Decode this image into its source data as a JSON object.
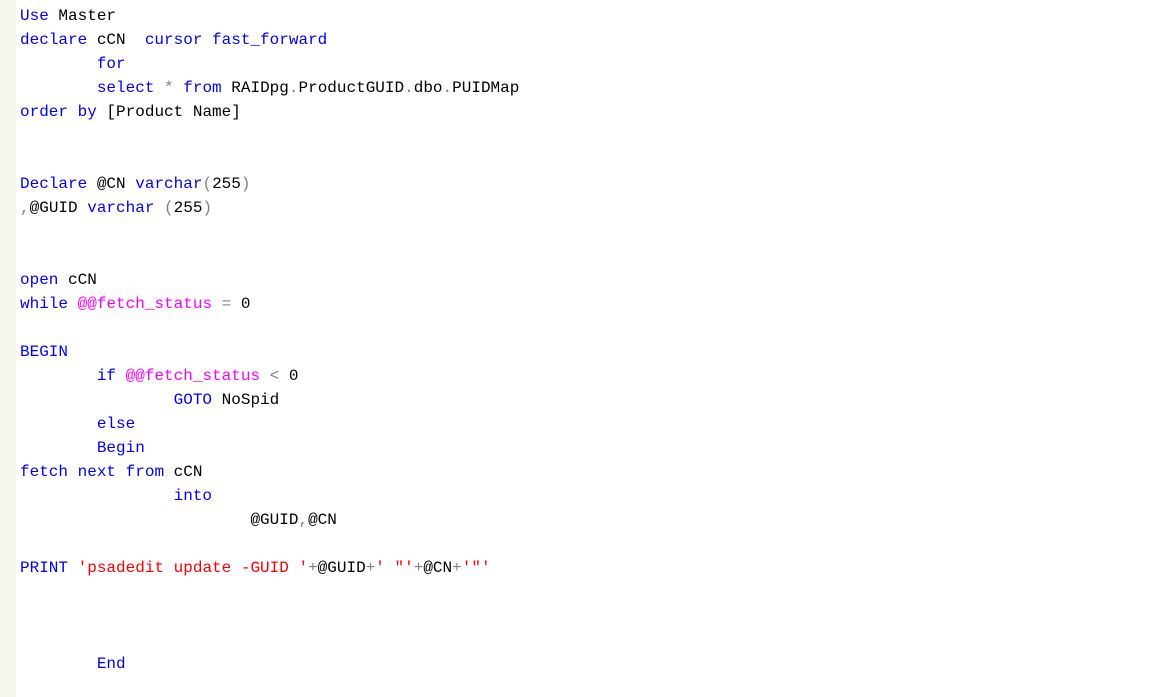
{
  "code": {
    "tokens": [
      [
        {
          "t": "Use",
          "c": "kw"
        },
        {
          "t": " Master",
          "c": "id"
        }
      ],
      [
        {
          "t": "declare",
          "c": "kw"
        },
        {
          "t": " cCN  ",
          "c": "id"
        },
        {
          "t": "cursor",
          "c": "kw"
        },
        {
          "t": " ",
          "c": "id"
        },
        {
          "t": "fast_forward",
          "c": "kw"
        }
      ],
      [
        {
          "t": "        ",
          "c": "id"
        },
        {
          "t": "for",
          "c": "kw"
        }
      ],
      [
        {
          "t": "        ",
          "c": "id"
        },
        {
          "t": "select",
          "c": "kw"
        },
        {
          "t": " ",
          "c": "id"
        },
        {
          "t": "*",
          "c": "op"
        },
        {
          "t": " ",
          "c": "id"
        },
        {
          "t": "from",
          "c": "kw"
        },
        {
          "t": " RAIDpg",
          "c": "id"
        },
        {
          "t": ".",
          "c": "op"
        },
        {
          "t": "ProductGUID",
          "c": "id"
        },
        {
          "t": ".",
          "c": "op"
        },
        {
          "t": "dbo",
          "c": "id"
        },
        {
          "t": ".",
          "c": "op"
        },
        {
          "t": "PUIDMap",
          "c": "id"
        }
      ],
      [
        {
          "t": "order",
          "c": "kw"
        },
        {
          "t": " ",
          "c": "id"
        },
        {
          "t": "by",
          "c": "kw"
        },
        {
          "t": " [Product Name]",
          "c": "id"
        }
      ],
      [],
      [],
      [
        {
          "t": "Declare",
          "c": "kw"
        },
        {
          "t": " @CN ",
          "c": "id"
        },
        {
          "t": "varchar",
          "c": "kw"
        },
        {
          "t": "(",
          "c": "op"
        },
        {
          "t": "255",
          "c": "id"
        },
        {
          "t": ")",
          "c": "op"
        }
      ],
      [
        {
          "t": ",",
          "c": "op"
        },
        {
          "t": "@GUID ",
          "c": "id"
        },
        {
          "t": "varchar",
          "c": "kw"
        },
        {
          "t": " ",
          "c": "id"
        },
        {
          "t": "(",
          "c": "op"
        },
        {
          "t": "255",
          "c": "id"
        },
        {
          "t": ")",
          "c": "op"
        }
      ],
      [],
      [],
      [
        {
          "t": "open",
          "c": "kw"
        },
        {
          "t": " cCN",
          "c": "id"
        }
      ],
      [
        {
          "t": "while",
          "c": "kw"
        },
        {
          "t": " ",
          "c": "id"
        },
        {
          "t": "@@fetch_status",
          "c": "sys"
        },
        {
          "t": " ",
          "c": "id"
        },
        {
          "t": "=",
          "c": "op"
        },
        {
          "t": " 0",
          "c": "id"
        }
      ],
      [],
      [
        {
          "t": "BEGIN",
          "c": "kw"
        }
      ],
      [
        {
          "t": "        ",
          "c": "id"
        },
        {
          "t": "if",
          "c": "kw"
        },
        {
          "t": " ",
          "c": "id"
        },
        {
          "t": "@@fetch_status",
          "c": "sys"
        },
        {
          "t": " ",
          "c": "id"
        },
        {
          "t": "<",
          "c": "op"
        },
        {
          "t": " 0",
          "c": "id"
        }
      ],
      [
        {
          "t": "                ",
          "c": "id"
        },
        {
          "t": "GOTO",
          "c": "kw"
        },
        {
          "t": " NoSpid",
          "c": "id"
        }
      ],
      [
        {
          "t": "        ",
          "c": "id"
        },
        {
          "t": "else",
          "c": "kw"
        }
      ],
      [
        {
          "t": "        ",
          "c": "id"
        },
        {
          "t": "Begin",
          "c": "kw"
        }
      ],
      [
        {
          "t": "fetch",
          "c": "kw"
        },
        {
          "t": " ",
          "c": "id"
        },
        {
          "t": "next",
          "c": "kw"
        },
        {
          "t": " ",
          "c": "id"
        },
        {
          "t": "from",
          "c": "kw"
        },
        {
          "t": " cCN",
          "c": "id"
        }
      ],
      [
        {
          "t": "                ",
          "c": "id"
        },
        {
          "t": "into",
          "c": "kw"
        }
      ],
      [
        {
          "t": "                        @GUID",
          "c": "id"
        },
        {
          "t": ",",
          "c": "op"
        },
        {
          "t": "@CN",
          "c": "id"
        }
      ],
      [],
      [
        {
          "t": "PRINT",
          "c": "kw"
        },
        {
          "t": " ",
          "c": "id"
        },
        {
          "t": "'psadedit update -GUID '",
          "c": "str"
        },
        {
          "t": "+",
          "c": "op"
        },
        {
          "t": "@GUID",
          "c": "id"
        },
        {
          "t": "+",
          "c": "op"
        },
        {
          "t": "' \"'",
          "c": "str"
        },
        {
          "t": "+",
          "c": "op"
        },
        {
          "t": "@CN",
          "c": "id"
        },
        {
          "t": "+",
          "c": "op"
        },
        {
          "t": "'\"'",
          "c": "str"
        }
      ],
      [],
      [],
      [],
      [
        {
          "t": "        ",
          "c": "id"
        },
        {
          "t": "End",
          "c": "kw"
        }
      ]
    ]
  }
}
